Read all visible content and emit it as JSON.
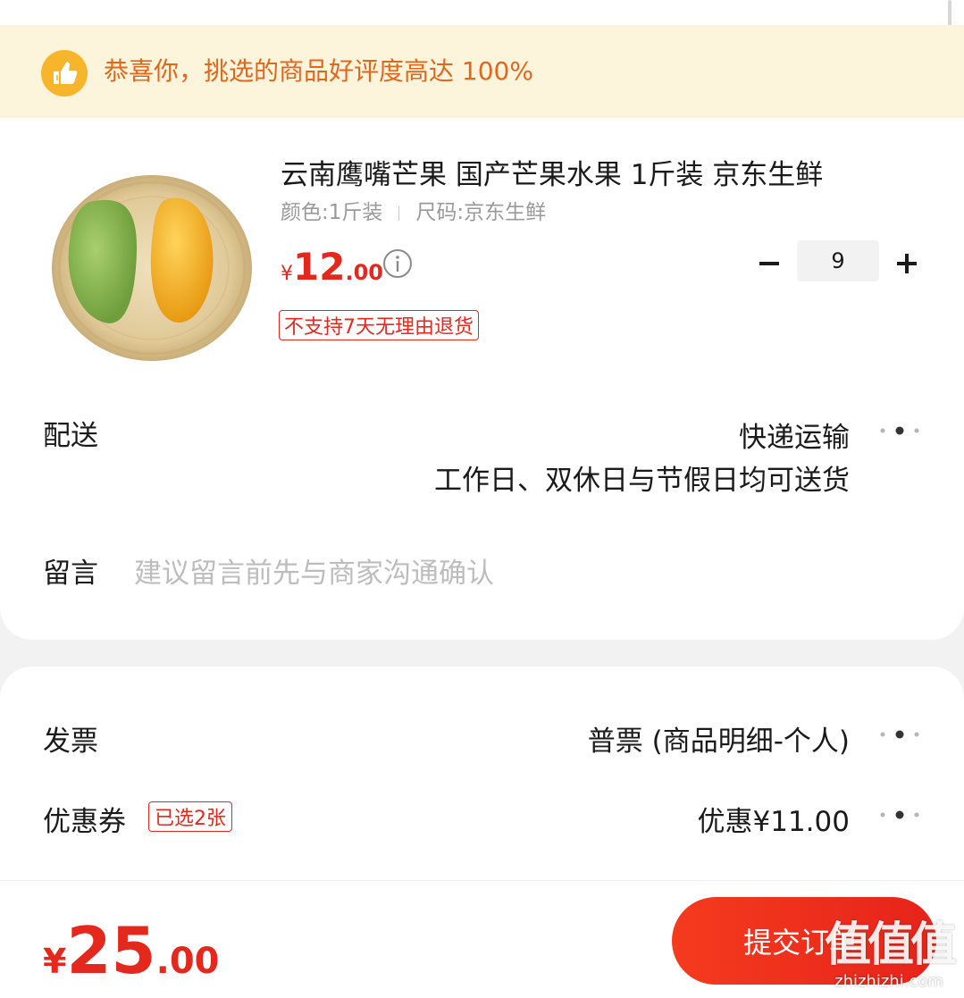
{
  "banner": {
    "text": "恭喜你，挑选的商品好评度高达 100%",
    "icon": "thumbs-up-icon",
    "icon_color": "#f7b52c",
    "text_color": "#e0681e",
    "background": "#fdf4dc"
  },
  "product": {
    "image": "mango-product-image",
    "title": "云南鹰嘴芒果 国产芒果水果 1斤装 京东生鲜",
    "color_spec": "颜色:1斤装",
    "size_spec": "尺码:京东生鲜",
    "price_symbol": "¥",
    "price_int": "12",
    "price_dec": ".00",
    "quantity": "9",
    "minus_label": "−",
    "plus_label": "+",
    "return_tag": "不支持7天无理由退货"
  },
  "delivery": {
    "label": "配送",
    "method": "快递运输",
    "note": "工作日、双休日与节假日均可送货"
  },
  "remark": {
    "label": "留言",
    "placeholder": "建议留言前先与商家沟通确认"
  },
  "invoice": {
    "label": "发票",
    "value": "普票 (商品明细-个人)"
  },
  "coupon": {
    "label": "优惠券",
    "tag": "已选2张",
    "value": "优惠¥11.00"
  },
  "footer": {
    "total_symbol": "¥",
    "total_int": "25",
    "total_dec": ".00",
    "submit_label": "提交订单"
  },
  "watermark": {
    "mark": "值值值",
    "url": "zhizhizhi.com"
  },
  "colors": {
    "accent_red": "#e4281e",
    "page_bg": "#f2f2f2"
  }
}
